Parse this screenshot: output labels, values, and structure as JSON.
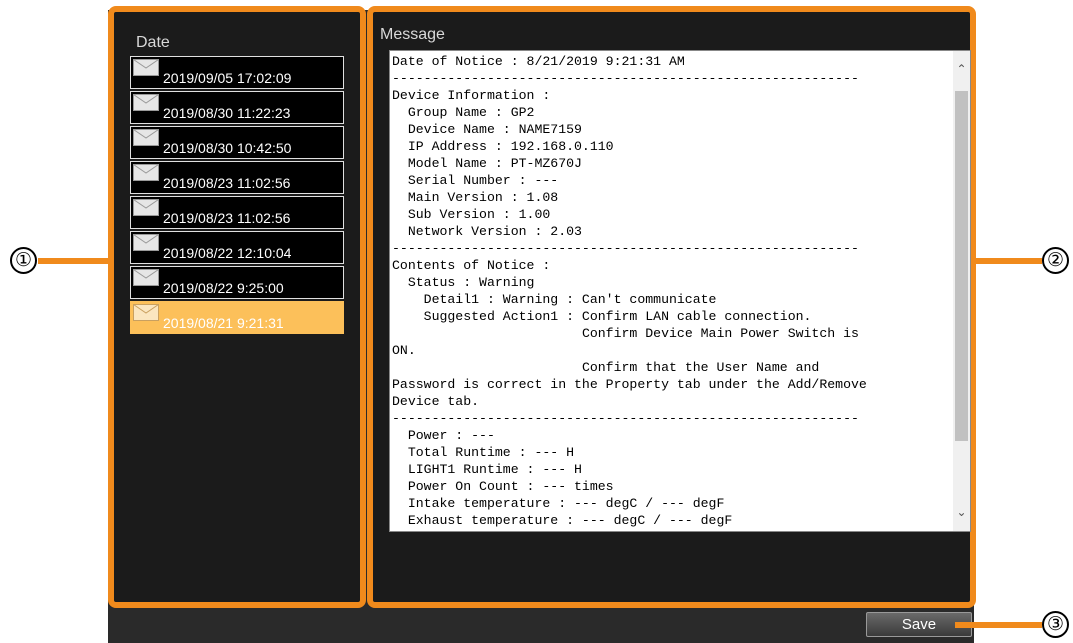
{
  "date_panel": {
    "title": "Date",
    "items": [
      {
        "label": "2019/09/05 17:02:09",
        "selected": false
      },
      {
        "label": "2019/08/30 11:22:23",
        "selected": false
      },
      {
        "label": "2019/08/30 10:42:50",
        "selected": false
      },
      {
        "label": "2019/08/23 11:02:56",
        "selected": false
      },
      {
        "label": "2019/08/23 11:02:56",
        "selected": false
      },
      {
        "label": "2019/08/22 12:10:04",
        "selected": false
      },
      {
        "label": "2019/08/22 9:25:00",
        "selected": false
      },
      {
        "label": "2019/08/21 9:21:31",
        "selected": true
      }
    ]
  },
  "message_panel": {
    "title": "Message",
    "text": "Date of Notice : 8/21/2019 9:21:31 AM\n-----------------------------------------------------------\nDevice Information :\n  Group Name : GP2\n  Device Name : NAME7159\n  IP Address : 192.168.0.110\n  Model Name : PT-MZ670J\n  Serial Number : ---\n  Main Version : 1.08\n  Sub Version : 1.00\n  Network Version : 2.03\n-----------------------------------------------------------\nContents of Notice :\n  Status : Warning\n    Detail1 : Warning : Can't communicate\n    Suggested Action1 : Confirm LAN cable connection.\n                        Confirm Device Main Power Switch is\nON.\n                        Confirm that the User Name and\nPassword is correct in the Property tab under the Add/Remove\nDevice tab.\n-----------------------------------------------------------\n  Power : ---\n  Total Runtime : --- H\n  LIGHT1 Runtime : --- H\n  Power On Count : --- times\n  Intake temperature : --- degC / --- degF\n  Exhaust temperature : --- degC / --- degF"
  },
  "save_button": {
    "label": "Save"
  },
  "callouts": [
    "①",
    "②",
    "③"
  ],
  "colors": {
    "accent": "#f08a1c",
    "selected": "#fcc05a"
  },
  "icons": {
    "mail": "envelope-icon",
    "scroll_up": "chevron-up-icon",
    "scroll_down": "chevron-down-icon"
  }
}
